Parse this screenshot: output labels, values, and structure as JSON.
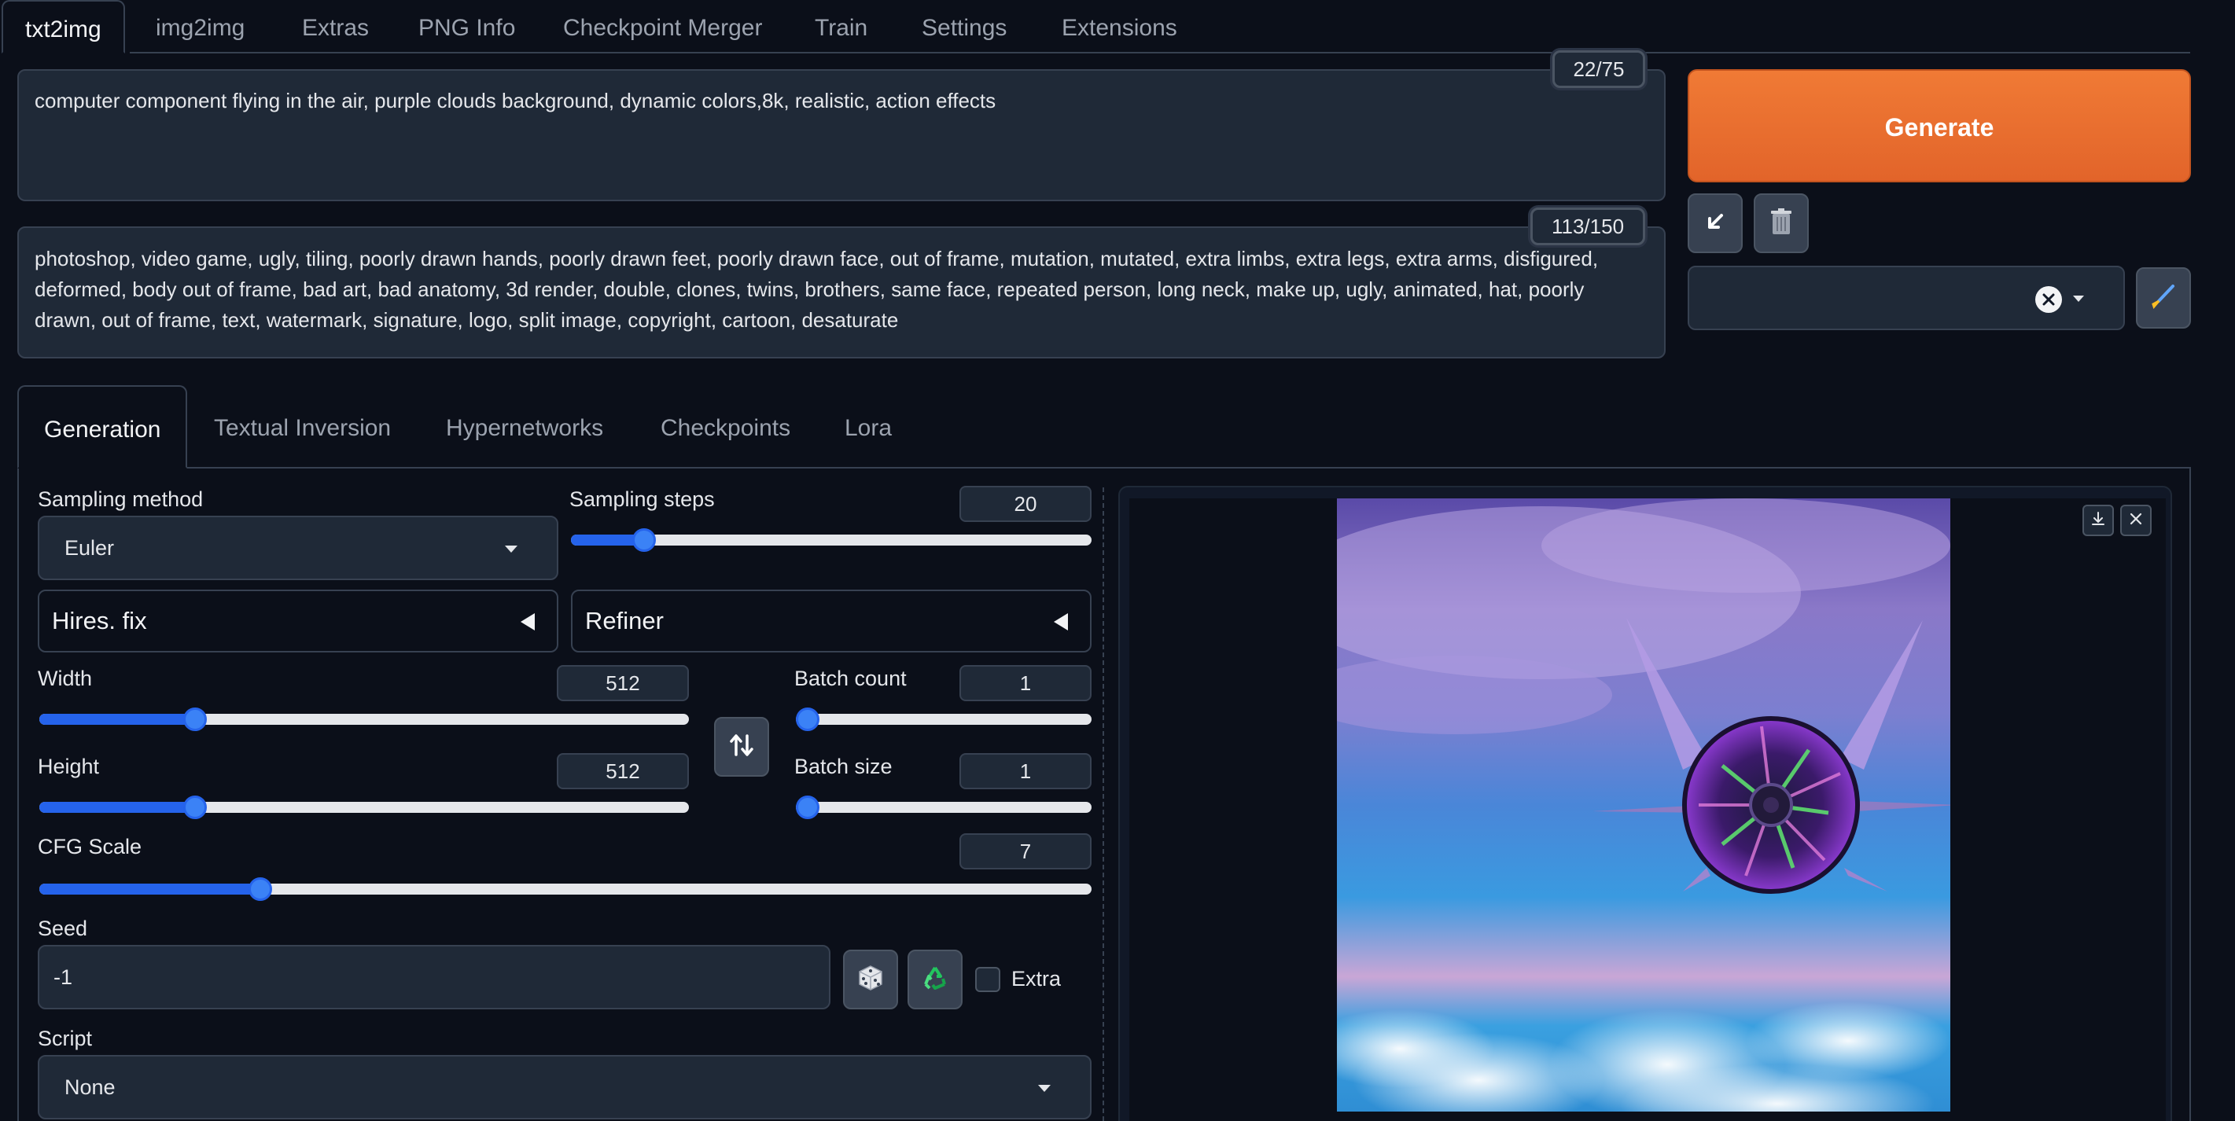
{
  "top_tabs": [
    "txt2img",
    "img2img",
    "Extras",
    "PNG Info",
    "Checkpoint Merger",
    "Train",
    "Settings",
    "Extensions"
  ],
  "prompt": {
    "text": "computer component flying in the air, purple clouds background, dynamic colors,8k, realistic, action effects",
    "token_count": "22/75"
  },
  "negative_prompt": {
    "text": "photoshop, video game, ugly, tiling, poorly drawn hands, poorly drawn feet, poorly drawn face, out of frame, mutation, mutated, extra limbs, extra legs, extra arms, disfigured, deformed, body out of frame, bad art, bad anatomy, 3d render, double, clones, twins, brothers, same face, repeated person, long neck, make up, ugly, animated, hat, poorly drawn, out of frame, text, watermark, signature, logo, split image, copyright, cartoon, desaturate",
    "token_count": "113/150"
  },
  "generate_label": "Generate",
  "gen_tabs": [
    "Generation",
    "Textual Inversion",
    "Hypernetworks",
    "Checkpoints",
    "Lora"
  ],
  "sampling": {
    "method_label": "Sampling method",
    "method_value": "Euler",
    "steps_label": "Sampling steps",
    "steps_value": "20",
    "steps_fraction": 0.14
  },
  "hires_fix_label": "Hires. fix",
  "refiner_label": "Refiner",
  "width": {
    "label": "Width",
    "value": "512",
    "fraction": 0.24
  },
  "height": {
    "label": "Height",
    "value": "512",
    "fraction": 0.24
  },
  "batch_count": {
    "label": "Batch count",
    "value": "1",
    "fraction": 0.0
  },
  "batch_size": {
    "label": "Batch size",
    "value": "1",
    "fraction": 0.0
  },
  "cfg_scale": {
    "label": "CFG Scale",
    "value": "7",
    "fraction": 0.21
  },
  "seed": {
    "label": "Seed",
    "value": "-1",
    "extra_label": "Extra"
  },
  "script": {
    "label": "Script",
    "value": "None"
  },
  "colors": {
    "accent": "#2563eb",
    "generate": "#e8692e",
    "background": "#0b0f19",
    "input": "#1f2937"
  },
  "icons": [
    "arrow-down-left-icon",
    "trash-icon",
    "clear-x-icon",
    "paintbrush-icon",
    "swap-icon",
    "dice-icon",
    "recycle-icon",
    "download-icon",
    "close-icon"
  ]
}
